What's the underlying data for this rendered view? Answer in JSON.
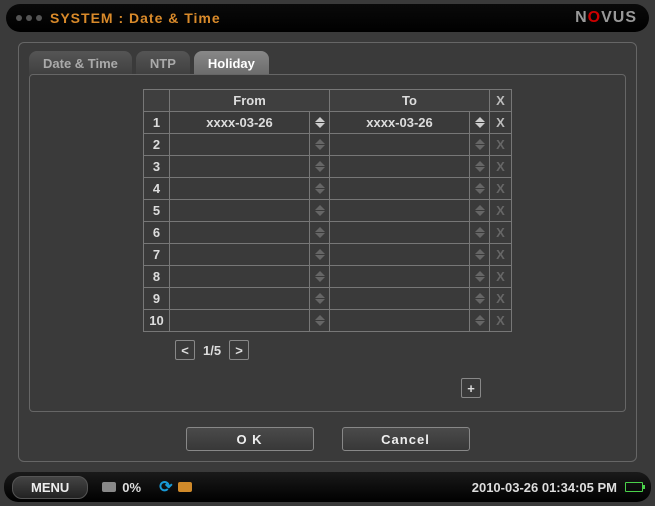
{
  "title": "SYSTEM : Date & Time",
  "brand": {
    "pre": "N",
    "o": "O",
    "post": "VUS"
  },
  "tabs": [
    {
      "label": "Date & Time",
      "active": false
    },
    {
      "label": "NTP",
      "active": false
    },
    {
      "label": "Holiday",
      "active": true
    }
  ],
  "table": {
    "headers": {
      "from": "From",
      "to": "To",
      "delete": "X"
    },
    "rows": [
      {
        "n": "1",
        "from": "xxxx-03-26",
        "to": "xxxx-03-26",
        "active": true
      },
      {
        "n": "2",
        "from": "",
        "to": "",
        "active": false
      },
      {
        "n": "3",
        "from": "",
        "to": "",
        "active": false
      },
      {
        "n": "4",
        "from": "",
        "to": "",
        "active": false
      },
      {
        "n": "5",
        "from": "",
        "to": "",
        "active": false
      },
      {
        "n": "6",
        "from": "",
        "to": "",
        "active": false
      },
      {
        "n": "7",
        "from": "",
        "to": "",
        "active": false
      },
      {
        "n": "8",
        "from": "",
        "to": "",
        "active": false
      },
      {
        "n": "9",
        "from": "",
        "to": "",
        "active": false
      },
      {
        "n": "10",
        "from": "",
        "to": "",
        "active": false
      }
    ]
  },
  "pager": {
    "prev": "<",
    "text": "1/5",
    "next": ">",
    "add": "+"
  },
  "buttons": {
    "ok": "O K",
    "cancel": "Cancel"
  },
  "status": {
    "menu": "MENU",
    "disk_pct": "0%",
    "datetime": "2010-03-26 01:34:05 PM"
  }
}
